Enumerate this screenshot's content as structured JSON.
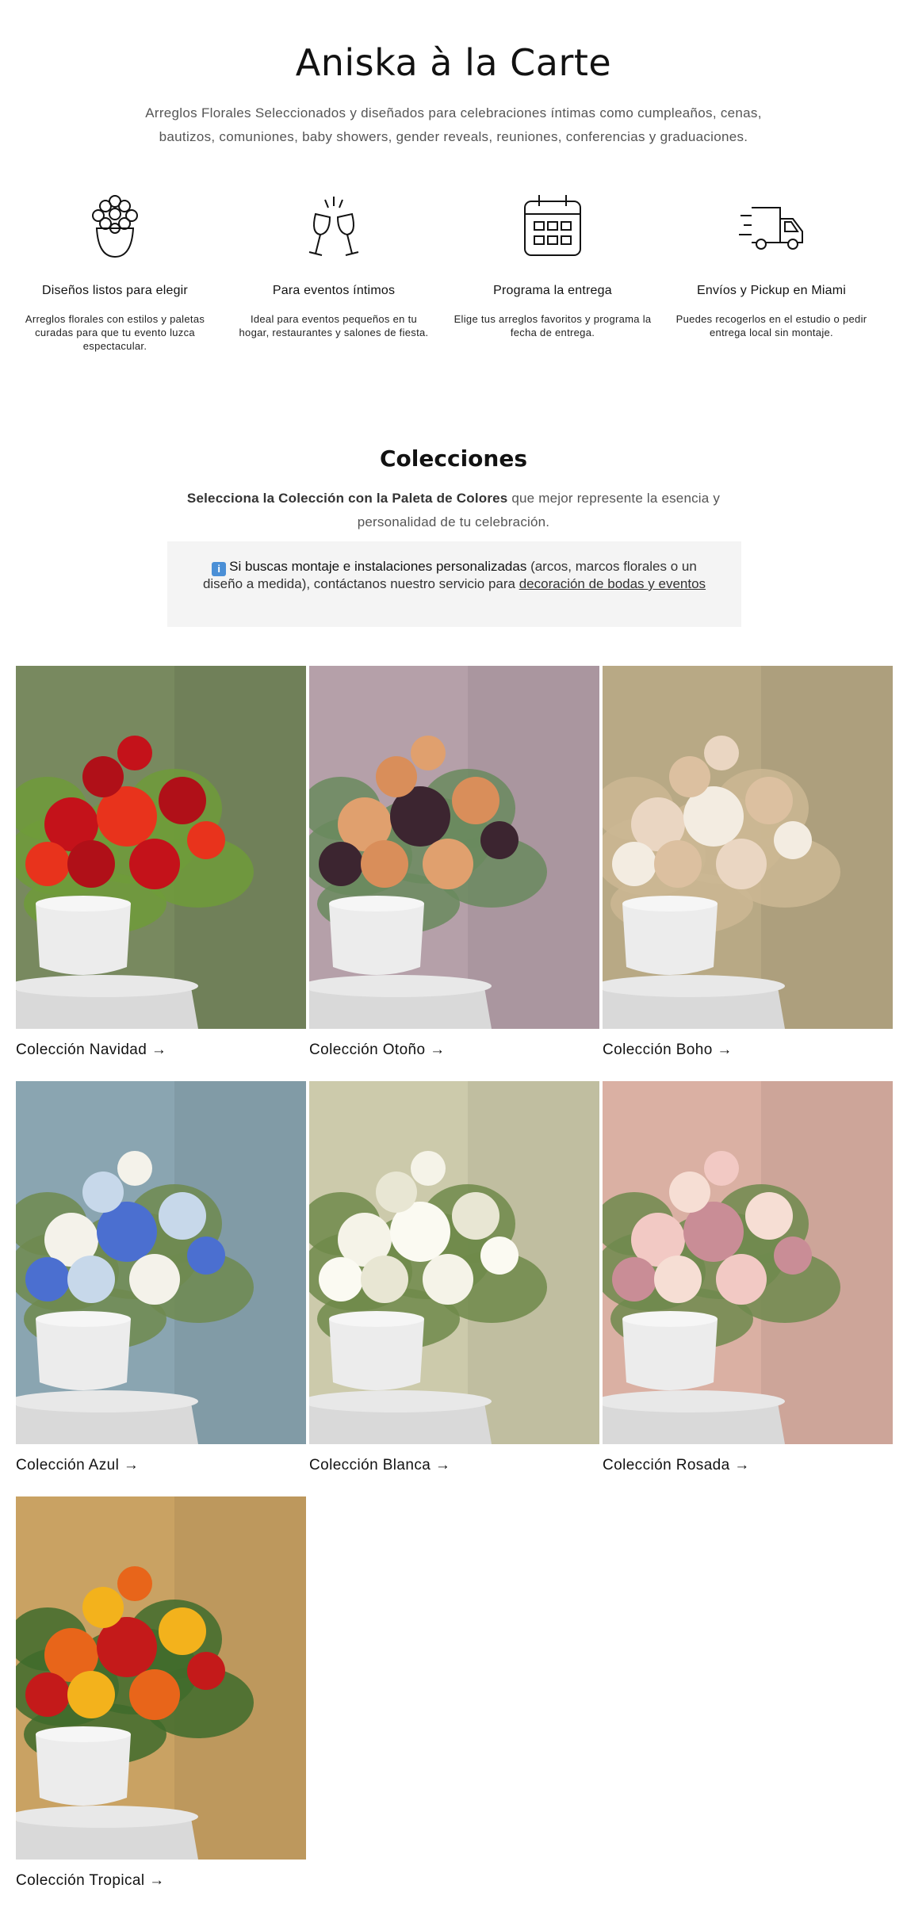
{
  "hero": {
    "title": "Aniska à la Carte",
    "subtitle": "Arreglos Florales Seleccionados y diseñados para celebraciones íntimas como cumpleaños, cenas, bautizos, comuniones, baby showers, gender reveals, reuniones, conferencias y graduaciones."
  },
  "features": [
    {
      "icon": "flower-bouquet-icon",
      "title": "Diseños listos para elegir",
      "desc": "Arreglos florales con estilos y paletas curadas para que tu evento luzca espectacular."
    },
    {
      "icon": "toast-glasses-icon",
      "title": "Para eventos íntimos",
      "desc": "Ideal para eventos pequeños en tu hogar, restaurantes y salones de fiesta."
    },
    {
      "icon": "calendar-icon",
      "title": "Programa la entrega",
      "desc": "Elige tus arreglos favoritos y programa la fecha de entrega."
    },
    {
      "icon": "delivery-truck-icon",
      "title": "Envíos y Pickup en Miami",
      "desc": "Puedes recogerlos en el estudio o pedir entrega local sin montaje."
    }
  ],
  "collections_section": {
    "title": "Colecciones",
    "desc_bold": "Selecciona la Colección con la Paleta de Colores",
    "desc_rest": " que mejor represente la esencia y personalidad de tu celebración.",
    "notice_icon": "ℹ️",
    "notice_strong": "Si buscas montaje e instalaciones personalizadas",
    "notice_text": " (arcos, marcos florales o un diseño a medida), contáctanos nuestro servicio para ",
    "notice_link": "decoración de bodas y eventos"
  },
  "collections": [
    {
      "label": "Colección Navidad →",
      "bg": "#78895f",
      "flowers": [
        "#c4121a",
        "#e8331c",
        "#b01018"
      ],
      "greens": "#6f9b3a"
    },
    {
      "label": "Colección Otoño →",
      "bg": "#b5a0a9",
      "flowers": [
        "#e0a06e",
        "#3c2530",
        "#d98e5a"
      ],
      "greens": "#6a8a5e"
    },
    {
      "label": "Colección Boho →",
      "bg": "#b8a985",
      "flowers": [
        "#ead6c2",
        "#f3ece1",
        "#dcc0a0"
      ],
      "greens": "#cbb793"
    },
    {
      "label": "Colección Azul →",
      "bg": "#8aa5b1",
      "flowers": [
        "#f4f2ea",
        "#4b6fd0",
        "#c7d8ea"
      ],
      "greens": "#6f8a4f"
    },
    {
      "label": "Colección Blanca →",
      "bg": "#cccaab",
      "flowers": [
        "#f5f3e8",
        "#fbfaf2",
        "#e8e6d3"
      ],
      "greens": "#6e8a4a"
    },
    {
      "label": "Colección Rosada →",
      "bg": "#dab0a3",
      "flowers": [
        "#f2c9c4",
        "#c98d96",
        "#f6ded4"
      ],
      "greens": "#6f8a4e"
    },
    {
      "label": "Colección Tropical →",
      "bg": "#c9a263",
      "flowers": [
        "#e8651a",
        "#c41a1a",
        "#f3b21c"
      ],
      "greens": "#3f6b2b"
    }
  ]
}
